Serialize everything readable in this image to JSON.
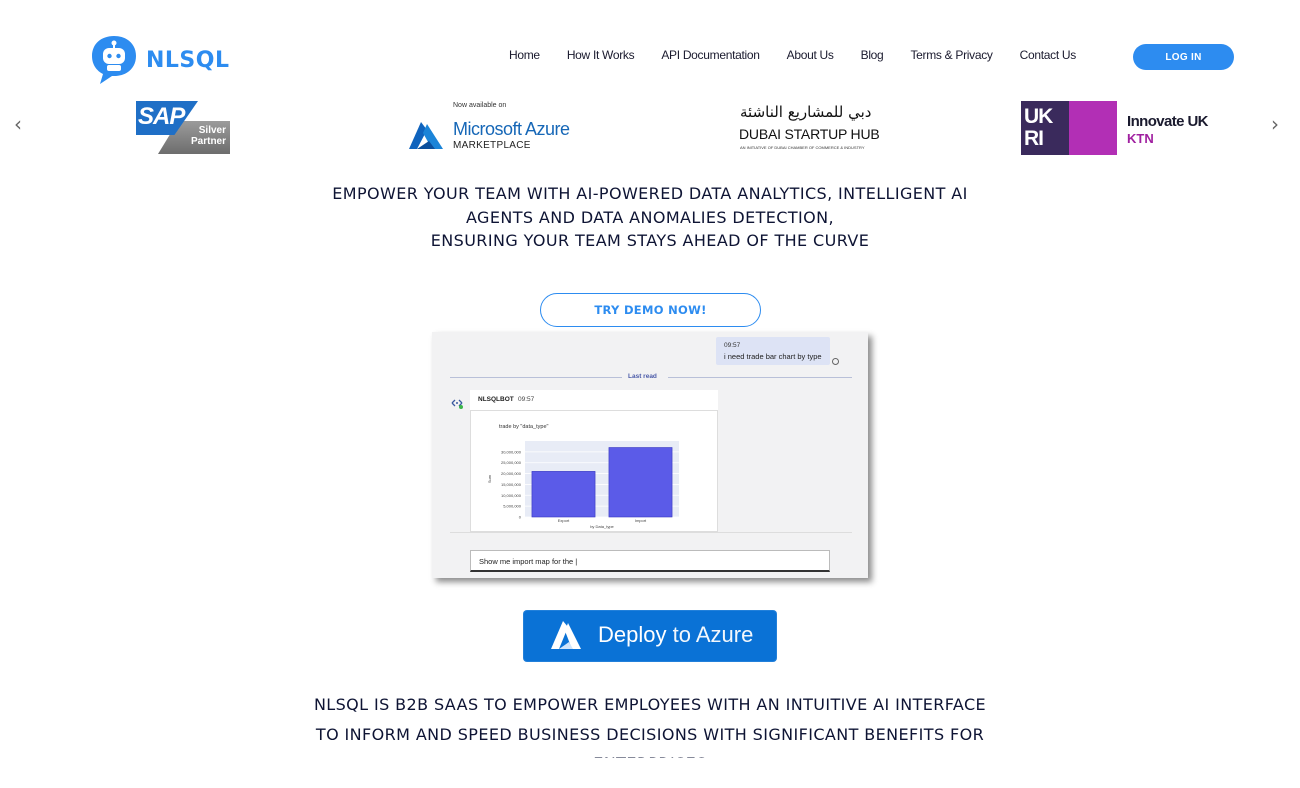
{
  "header": {
    "logo_text": "NLSQL",
    "nav": [
      "Home",
      "How It Works",
      "API Documentation",
      "About Us",
      "Blog",
      "Terms & Privacy",
      "Contact Us"
    ],
    "login_label": "LOG IN"
  },
  "partners": {
    "sap": {
      "brand": "SAP",
      "badge_line1": "Silver",
      "badge_line2": "Partner"
    },
    "azure": {
      "available": "Now available on",
      "name": "Microsoft Azure",
      "sub": "MARKETPLACE"
    },
    "dubai": {
      "arabic": "دبي للمشاريع الناشئة",
      "english": "DUBAI STARTUP HUB",
      "sub": "AN INITIATIVE OF DUBAI CHAMBER OF COMMERCE & INDUSTRY"
    },
    "ukri": {
      "letters": "UK RI",
      "title": "Innovate UK",
      "sub": "KTN"
    }
  },
  "hero": {
    "headline_line1": "Empower your team with AI-powered data analytics, Intelligent AI",
    "headline_line2": "Agents and Data Anomalies Detection,",
    "headline_line3": "ensuring your team stays ahead of the curve",
    "demo_button": "TRY DEMO NOW!"
  },
  "demo": {
    "user_time": "09:57",
    "user_message": "i need trade bar chart by type",
    "last_read": "Last read",
    "bot_name": "NLSQLBOT",
    "bot_time": "09:57",
    "chart_title": "trade by \"data_type\"",
    "input_value": "Show me import map for the |"
  },
  "chart_data": {
    "type": "bar",
    "title": "trade by \"data_type\"",
    "categories": [
      "Export",
      "Import"
    ],
    "values": [
      21000000,
      32000000
    ],
    "xlabel": "by Data_type",
    "ylabel": "Sum",
    "yticks": [
      "0",
      "5,000,000",
      "10,000,000",
      "15,000,000",
      "20,000,000",
      "25,000,000",
      "30,000,000"
    ],
    "ylim": [
      0,
      35000000
    ],
    "colors": [
      "#5b5be8"
    ]
  },
  "deploy": {
    "label_strong": "Deploy",
    "label_light": "to Azure"
  },
  "tagline": {
    "text": "NLSQL is B2B SaaS to empower employees with an intuitive AI interface to inform and speed business decisions with significant benefits for Enterprises"
  },
  "carousel": {
    "prev_icon": "chevron-left-icon",
    "next_icon": "chevron-right-icon"
  }
}
